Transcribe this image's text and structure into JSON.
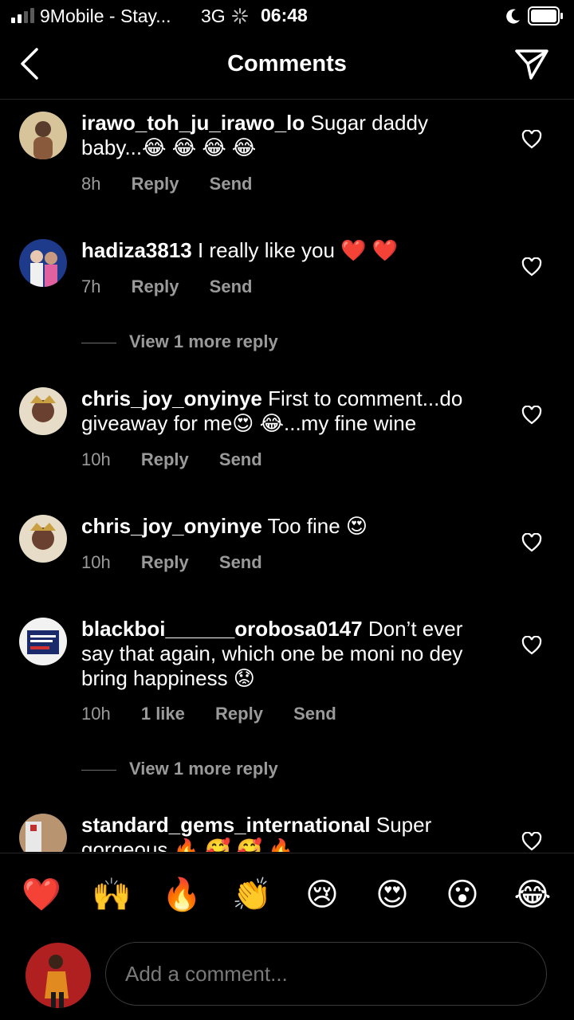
{
  "status_bar": {
    "carrier": "9Mobile - Stay...",
    "network": "3G",
    "time": "06:48"
  },
  "header": {
    "title": "Comments"
  },
  "comments": [
    {
      "user": "irawo_toh_ju_irawo_lo",
      "text": " Sugar daddy baby...😂 😂  😂  😂",
      "time": "8h",
      "likes": "",
      "reply": "Reply",
      "send": "Send"
    },
    {
      "user": "hadiza3813",
      "text": " I really like you ❤️ ❤️",
      "time": "7h",
      "likes": "",
      "reply": "Reply",
      "send": "Send",
      "view_more": "View 1 more reply"
    },
    {
      "user": "chris_joy_onyinye",
      "text": " First to comment...do giveaway for me😍 😂...my fine wine",
      "time": "10h",
      "likes": "",
      "reply": "Reply",
      "send": "Send"
    },
    {
      "user": "chris_joy_onyinye",
      "text": " Too fine 😍",
      "time": "10h",
      "likes": "",
      "reply": "Reply",
      "send": "Send"
    },
    {
      "user": "blackboi______orobosa0147",
      "text": " Don’t ever say that again, which one be moni no dey bring happiness 😟",
      "time": "10h",
      "likes": "1 like",
      "reply": "Reply",
      "send": "Send",
      "view_more": "View 1 more reply"
    },
    {
      "user": "standard_gems_international",
      "text": " Super gorgeous 🔥 🥰 🥰 🔥"
    }
  ],
  "emoji_bar": [
    "❤️",
    "🙌",
    "🔥",
    "👏",
    "😢",
    "😍",
    "😮",
    "😂"
  ],
  "composer": {
    "placeholder": "Add a comment..."
  },
  "colors": {
    "background": "#000000",
    "meta_text": "#9a9a9a",
    "divider": "#262626"
  }
}
